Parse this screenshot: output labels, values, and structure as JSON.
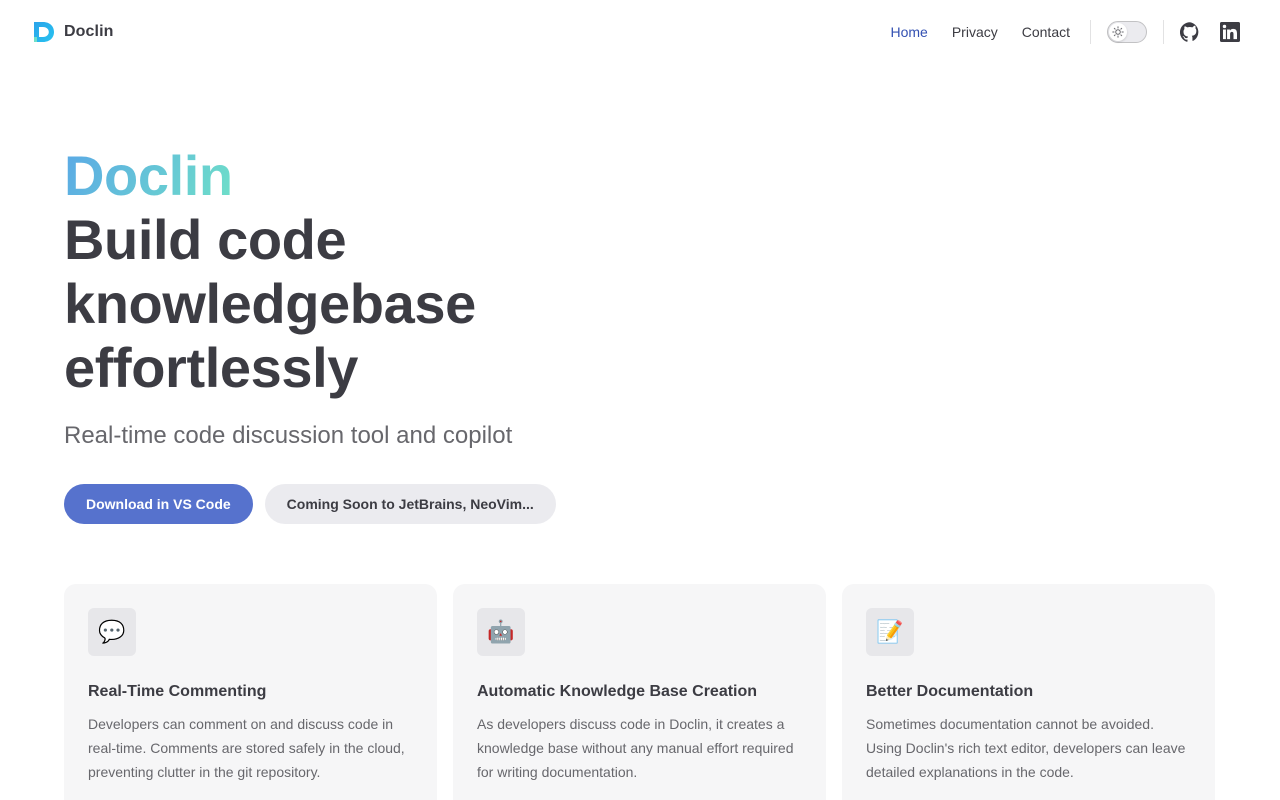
{
  "header": {
    "brand_name": "Doclin",
    "nav": [
      {
        "label": "Home",
        "active": true
      },
      {
        "label": "Privacy",
        "active": false
      },
      {
        "label": "Contact",
        "active": false
      }
    ],
    "social": [
      {
        "icon": "github-icon"
      },
      {
        "icon": "linkedin-icon"
      }
    ],
    "theme_toggle_icon": "sun-icon"
  },
  "hero": {
    "name": "Doclin",
    "text": "Build code knowledgebase effortlessly",
    "tagline": "Real-time code discussion tool and copilot",
    "actions": [
      {
        "label": "Download in VS Code",
        "theme": "brand"
      },
      {
        "label": "Coming Soon to JetBrains, NeoVim...",
        "theme": "alt"
      }
    ]
  },
  "features": [
    {
      "icon": "💬",
      "icon_name": "speech-bubble-icon",
      "title": "Real-Time Commenting",
      "details": "Developers can comment on and discuss code in real-time. Comments are stored safely in the cloud, preventing clutter in the git repository."
    },
    {
      "icon": "🤖",
      "icon_name": "robot-icon",
      "title": "Automatic Knowledge Base Creation",
      "details": "As developers discuss code in Doclin, it creates a knowledge base without any manual effort required for writing documentation."
    },
    {
      "icon": "📝",
      "icon_name": "memo-icon",
      "title": "Better Documentation",
      "details": "Sometimes documentation cannot be avoided. Using Doclin's rich text editor, developers can leave detailed explanations in the code."
    }
  ],
  "colors": {
    "accent": "#3451b2",
    "brand_button": "#5672cd",
    "gradient_start": "#5aa8e6",
    "gradient_end": "#6fe0c8"
  }
}
